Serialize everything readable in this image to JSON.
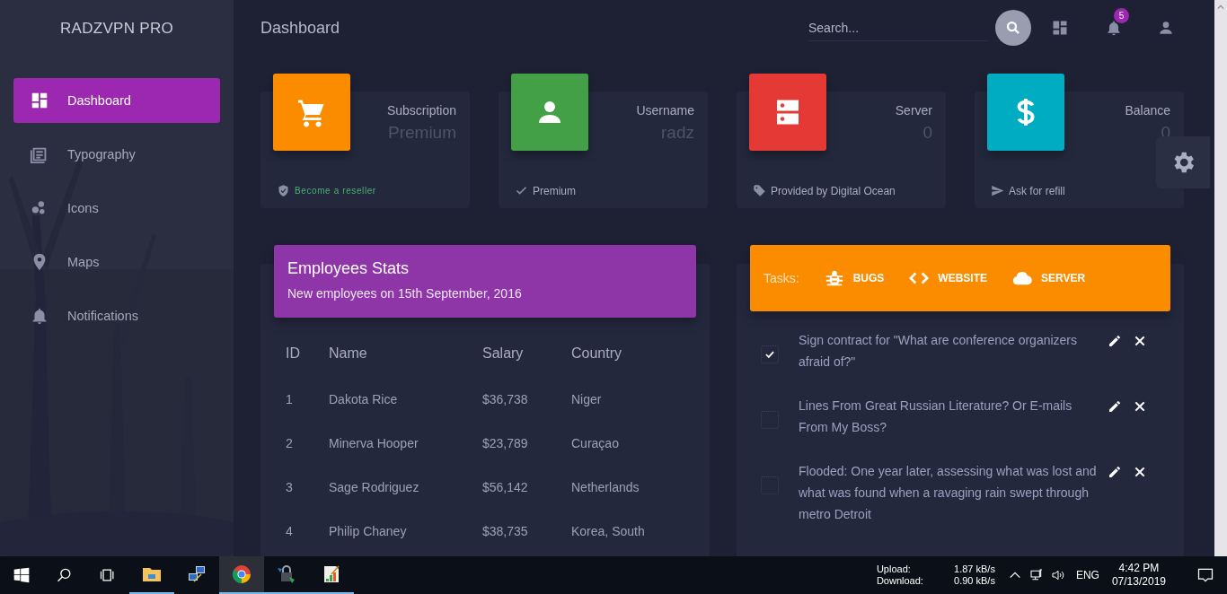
{
  "sidebar": {
    "brand": "RADZVPN PRO",
    "items": [
      {
        "label": "Dashboard",
        "selected": true
      },
      {
        "label": "Typography",
        "selected": false
      },
      {
        "label": "Icons",
        "selected": false
      },
      {
        "label": "Maps",
        "selected": false
      },
      {
        "label": "Notifications",
        "selected": false
      }
    ]
  },
  "header": {
    "title": "Dashboard",
    "search": {
      "placeholder": "Search..."
    },
    "notification_count": "5"
  },
  "stat_cards": [
    {
      "title": "Subscription",
      "value": "Premium",
      "footer": "Become a reseller",
      "color": "#fb8c00"
    },
    {
      "title": "Username",
      "value": "radz",
      "footer": "Premium",
      "color": "#43a047"
    },
    {
      "title": "Server",
      "value": "0",
      "footer": "Provided by Digital Ocean",
      "color": "#e53935"
    },
    {
      "title": "Balance",
      "value": "0",
      "footer": "Ask for refill",
      "color": "#00acc1"
    }
  ],
  "employees": {
    "title": "Employees Stats",
    "subtitle": "New employees on 15th September, 2016",
    "columns": [
      "ID",
      "Name",
      "Salary",
      "Country"
    ],
    "rows": [
      [
        "1",
        "Dakota Rice",
        "$36,738",
        "Niger"
      ],
      [
        "2",
        "Minerva Hooper",
        "$23,789",
        "Curaçao"
      ],
      [
        "3",
        "Sage Rodriguez",
        "$56,142",
        "Netherlands"
      ],
      [
        "4",
        "Philip Chaney",
        "$38,735",
        "Korea, South"
      ]
    ]
  },
  "tasks": {
    "label": "Tasks:",
    "tabs": [
      {
        "label": "BUGS"
      },
      {
        "label": "WEBSITE"
      },
      {
        "label": "SERVER"
      }
    ],
    "items": [
      {
        "text": "Sign contract for \"What are conference organizers afraid of?\"",
        "checked": true
      },
      {
        "text": "Lines From Great Russian Literature? Or E-mails From My Boss?",
        "checked": false
      },
      {
        "text": "Flooded: One year later, assessing what was lost and what was found when a ravaging rain swept through metro Detroit",
        "checked": false
      }
    ]
  },
  "taskbar": {
    "apps": [
      {
        "running": true,
        "selected": false
      },
      {
        "running": false,
        "selected": false
      },
      {
        "running": true,
        "selected": true
      },
      {
        "running": true,
        "selected": false
      },
      {
        "running": true,
        "selected": false
      }
    ],
    "upload_label": "Upload:",
    "upload_value": "1.87 kB/s",
    "download_label": "Download:",
    "download_value": "0.90 kB/s",
    "language": "ENG",
    "time": "4:42 PM",
    "date": "07/13/2019"
  }
}
